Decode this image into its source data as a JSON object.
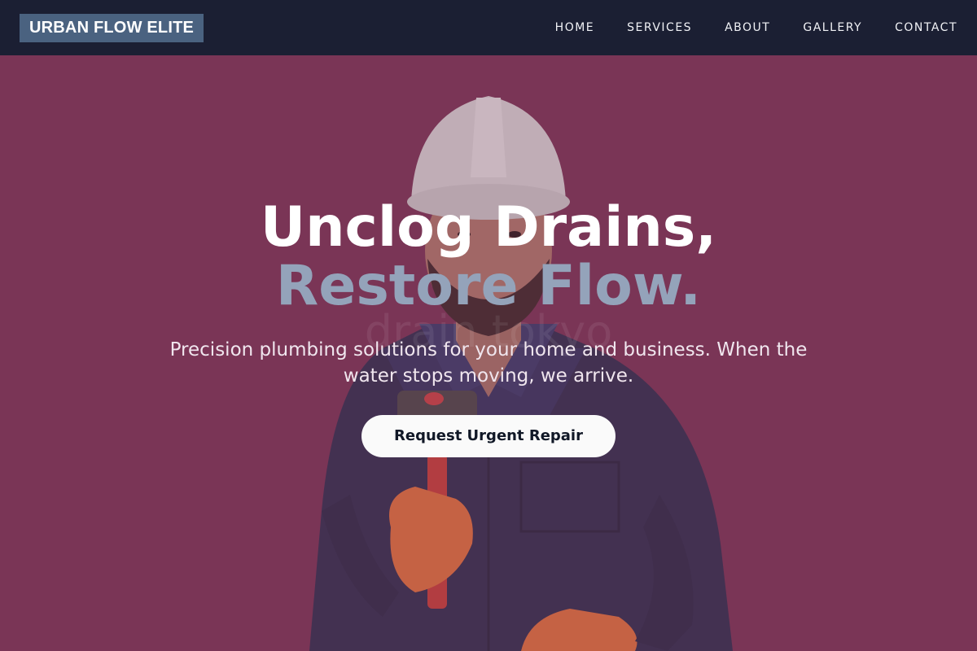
{
  "brand": {
    "name": "URBAN FLOW ELITE"
  },
  "nav": {
    "items": [
      {
        "label": "HOME"
      },
      {
        "label": "SERVICES"
      },
      {
        "label": "ABOUT"
      },
      {
        "label": "GALLERY"
      },
      {
        "label": "CONTACT"
      }
    ]
  },
  "hero": {
    "headline_line1": "Unclog Drains,",
    "headline_line2": "Restore Flow.",
    "watermark": "drain tokyo",
    "subtitle": "Precision plumbing solutions for your home and business. When the water stops moving, we arrive.",
    "cta_label": "Request Urgent Repair",
    "image": "plumber-photo"
  },
  "colors": {
    "nav_bg": "#1b1f33",
    "brand_bg": "#4a6280",
    "hero_bg": "#7a3556",
    "headline_accent": "#94a3ba",
    "cta_bg": "#fafafa",
    "cta_text": "#111827"
  }
}
